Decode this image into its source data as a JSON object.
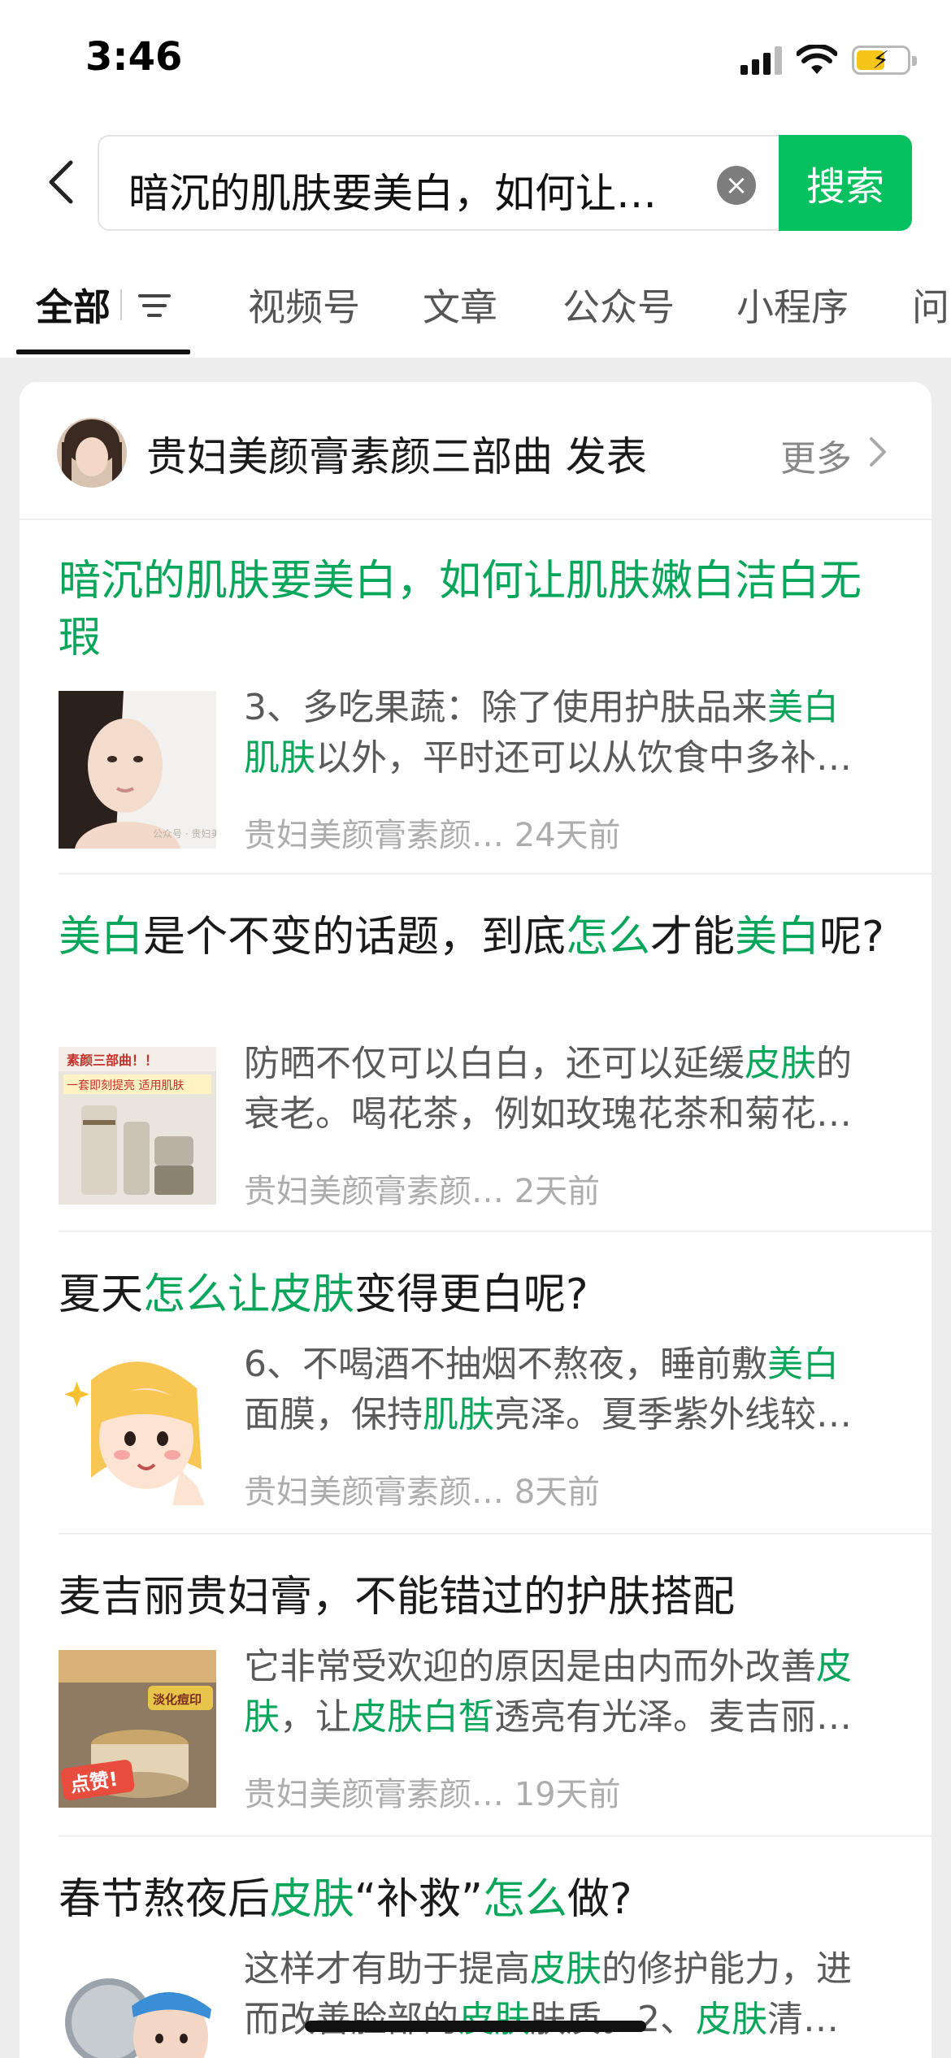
{
  "status_bar": {
    "time": "3:46",
    "battery_color": "#f5c518"
  },
  "search": {
    "query": "暗沉的肌肤要美白，如何让…",
    "button_label": "搜索",
    "accent": "#07c160"
  },
  "tabs": [
    "全部",
    "视频号",
    "文章",
    "公众号",
    "小程序",
    "问"
  ],
  "active_tab": "全部",
  "card": {
    "author": "贵妇美颜膏素颜三部曲 发表",
    "more_label": "更多"
  },
  "articles": [
    {
      "title_segments": [
        {
          "t": "暗沉的肌肤要美白，如何让肌肤嫩白洁白无瑕",
          "h": true
        }
      ],
      "snippet_line1": [
        {
          "t": "3、多吃果蔬：除了使用护肤品来",
          "h": false
        },
        {
          "t": "美白",
          "h": true
        }
      ],
      "snippet_line2": [
        {
          "t": "肌肤",
          "h": true
        },
        {
          "t": "以外，平时还可以从饮食中多补…",
          "h": false
        }
      ],
      "source": "贵妇美颜膏素颜…",
      "time": "24天前",
      "thumb_icon": "woman-portrait-thumbnail",
      "watermark": "公众号 · 贵妇美颜"
    },
    {
      "title_segments": [
        {
          "t": "美白",
          "h": true
        },
        {
          "t": "是个不变的话题，到底",
          "h": false
        },
        {
          "t": "怎么",
          "h": true
        },
        {
          "t": "才能",
          "h": false
        },
        {
          "t": "美白",
          "h": true
        },
        {
          "t": "呢?",
          "h": false
        }
      ],
      "snippet_line1": [
        {
          "t": "防晒不仅可以白白，还可以延缓",
          "h": false
        },
        {
          "t": "皮肤",
          "h": true
        },
        {
          "t": "的",
          "h": false
        }
      ],
      "snippet_line2": [
        {
          "t": "衰老。喝花茶，例如玫瑰花茶和菊花…",
          "h": false
        }
      ],
      "source": "贵妇美颜膏素颜…",
      "time": "2天前",
      "thumb_icon": "skincare-products-thumbnail",
      "thumb_text_top": "素颜三部曲！！",
      "thumb_text_mid": "一套即刻提亮 适用肌肤"
    },
    {
      "title_segments": [
        {
          "t": "夏天",
          "h": false
        },
        {
          "t": "怎么让皮肤",
          "h": true
        },
        {
          "t": "变得更白呢?",
          "h": false
        }
      ],
      "snippet_line1": [
        {
          "t": "6、不喝酒不抽烟不熬夜，睡前敷",
          "h": false
        },
        {
          "t": "美白",
          "h": true
        }
      ],
      "snippet_line2": [
        {
          "t": "面膜，保持",
          "h": false
        },
        {
          "t": "肌肤",
          "h": true
        },
        {
          "t": "亮泽。夏季紫外线较…",
          "h": false
        }
      ],
      "source": "贵妇美颜膏素颜…",
      "time": "8天前",
      "thumb_icon": "cartoon-girl-thumbnail"
    },
    {
      "title_segments": [
        {
          "t": "麦吉丽贵妇膏，不能错过的护肤搭配",
          "h": false
        }
      ],
      "snippet_line1": [
        {
          "t": "它非常受欢迎的原因是由内而外改善",
          "h": false
        },
        {
          "t": "皮",
          "h": true
        }
      ],
      "snippet_line2": [
        {
          "t": "肤",
          "h": true
        },
        {
          "t": "，让",
          "h": false
        },
        {
          "t": "皮肤白皙",
          "h": true
        },
        {
          "t": "透亮有光泽。麦吉丽…",
          "h": false
        }
      ],
      "source": "贵妇美颜膏素颜…",
      "time": "19天前",
      "thumb_icon": "cream-jar-thumbnail",
      "thumb_badge": "点赞!",
      "thumb_tag": "淡化痘印"
    },
    {
      "title_segments": [
        {
          "t": "春节熬夜后",
          "h": false
        },
        {
          "t": "皮肤",
          "h": true
        },
        {
          "t": "“补救”",
          "h": false
        },
        {
          "t": "怎么",
          "h": true
        },
        {
          "t": "做?",
          "h": false
        }
      ],
      "snippet_line1": [
        {
          "t": "这样才有助于提高",
          "h": false
        },
        {
          "t": "皮肤",
          "h": true
        },
        {
          "t": "的修护能力，进",
          "h": false
        }
      ],
      "snippet_line2": [
        {
          "t": "而改善脸部的",
          "h": false
        },
        {
          "t": "皮肤",
          "h": true
        },
        {
          "t": "肤质。2、",
          "h": false
        },
        {
          "t": "皮肤",
          "h": true
        },
        {
          "t": "清…",
          "h": false
        }
      ],
      "source": "",
      "time": "",
      "thumb_icon": "mirror-girl-thumbnail"
    }
  ]
}
